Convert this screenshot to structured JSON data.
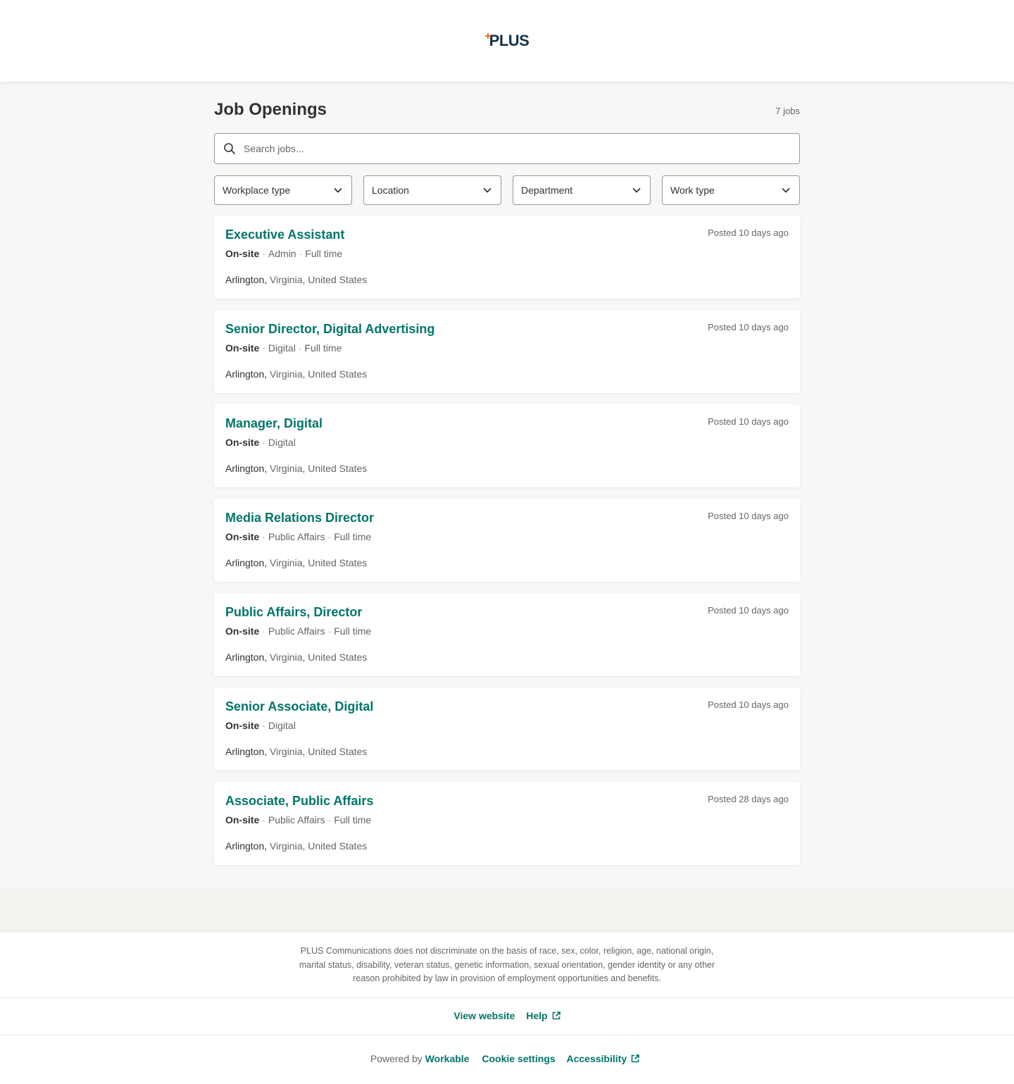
{
  "header": {
    "logo_text": "PLUS"
  },
  "page": {
    "title": "Job Openings",
    "job_count": "7 jobs"
  },
  "search": {
    "placeholder": "Search jobs..."
  },
  "filters": [
    {
      "label": "Workplace type"
    },
    {
      "label": "Location"
    },
    {
      "label": "Department"
    },
    {
      "label": "Work type"
    }
  ],
  "jobs": [
    {
      "title": "Executive Assistant",
      "posted": "Posted 10 days ago",
      "workplace": "On-site",
      "department": "Admin",
      "type": "Full time",
      "city": "Arlington,",
      "region": "Virginia, United States"
    },
    {
      "title": "Senior Director, Digital Advertising",
      "posted": "Posted 10 days ago",
      "workplace": "On-site",
      "department": "Digital",
      "type": "Full time",
      "city": "Arlington,",
      "region": "Virginia, United States"
    },
    {
      "title": "Manager, Digital",
      "posted": "Posted 10 days ago",
      "workplace": "On-site",
      "department": "Digital",
      "type": "",
      "city": "Arlington,",
      "region": "Virginia, United States"
    },
    {
      "title": "Media Relations Director",
      "posted": "Posted 10 days ago",
      "workplace": "On-site",
      "department": "Public Affairs",
      "type": "Full time",
      "city": "Arlington,",
      "region": "Virginia, United States"
    },
    {
      "title": "Public Affairs, Director",
      "posted": "Posted 10 days ago",
      "workplace": "On-site",
      "department": "Public Affairs",
      "type": "Full time",
      "city": "Arlington,",
      "region": "Virginia, United States"
    },
    {
      "title": "Senior Associate, Digital",
      "posted": "Posted 10 days ago",
      "workplace": "On-site",
      "department": "Digital",
      "type": "",
      "city": "Arlington,",
      "region": "Virginia, United States"
    },
    {
      "title": "Associate, Public Affairs",
      "posted": "Posted 28 days ago",
      "workplace": "On-site",
      "department": "Public Affairs",
      "type": "Full time",
      "city": "Arlington,",
      "region": "Virginia, United States"
    }
  ],
  "footer": {
    "disclaimer": "PLUS Communications does not discriminate on the basis of race, sex, color, religion, age, national origin, marital status, disability, veteran status, genetic information, sexual orientation, gender identity or any other reason prohibited by law in provision of employment opportunities and benefits.",
    "view_website": "View website",
    "help": "Help",
    "powered_by": "Powered by",
    "workable": "Workable",
    "cookie_settings": "Cookie settings",
    "accessibility": "Accessibility"
  },
  "colors": {
    "accent": "#00756a",
    "logo": "#123249",
    "logo_mark": "#e8702a",
    "background": "#f9f7f5"
  },
  "icons": {
    "search": "search-icon",
    "chevron": "chevron-down-icon",
    "external": "external-link-icon"
  }
}
